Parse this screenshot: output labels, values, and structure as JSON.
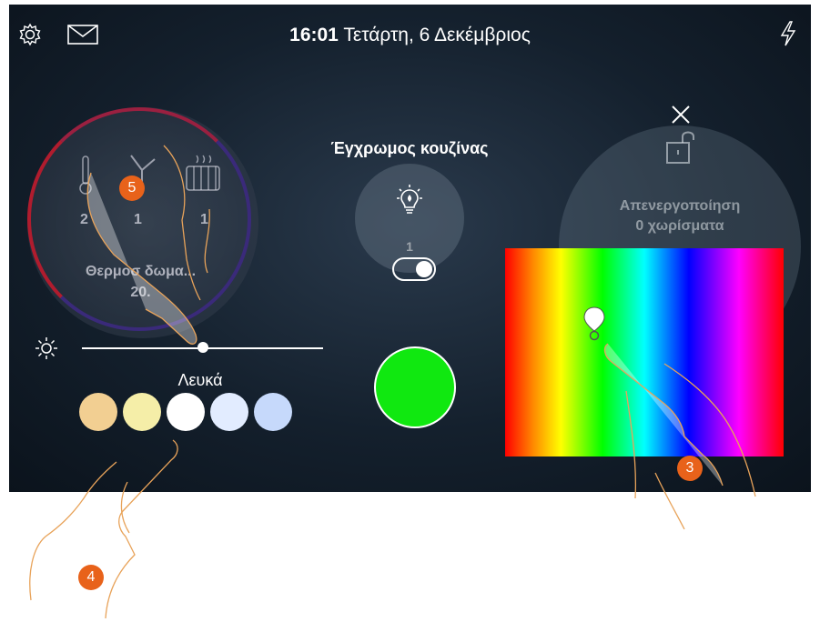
{
  "header": {
    "time": "16:01",
    "date": "Τετάρτη, 6 Δεκέμβριος"
  },
  "thermostat": {
    "values": [
      "2",
      "1",
      "1"
    ],
    "label": "Θερμοσ   δωμα...",
    "temperature": "20."
  },
  "light": {
    "title": "Έγχρωμος κουζίνας",
    "count": "1",
    "toggle_on": true,
    "selected_color": "#10e810"
  },
  "lock": {
    "line1": "Απενεργοποίηση",
    "line2": "0 χωρίσματα"
  },
  "white_panel": {
    "label": "Λευκά",
    "swatches": [
      "#f2cf92",
      "#f5eea8",
      "#ffffff",
      "#e2ecff",
      "#c6d9fb"
    ],
    "brightness": 0.5
  },
  "callouts": [
    "5",
    "4",
    "3"
  ],
  "icons": [
    "gear-icon",
    "mail-icon",
    "flash-icon",
    "close-icon",
    "unlock-icon",
    "bulb-icon",
    "sun-icon",
    "thermometer-icon",
    "fan-icon",
    "radiator-icon"
  ]
}
